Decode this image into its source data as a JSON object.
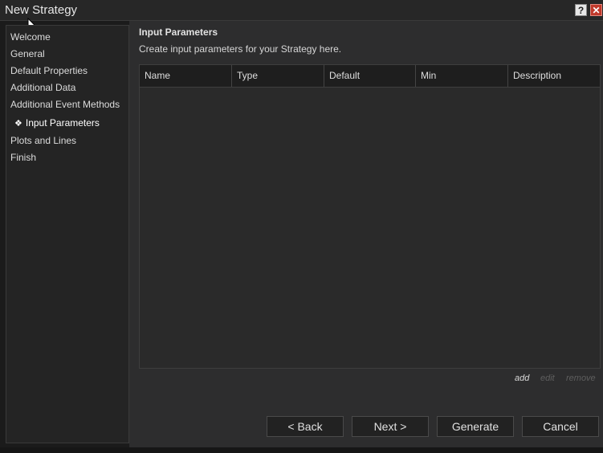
{
  "window": {
    "title": "New Strategy",
    "help_glyph": "?",
    "close_glyph": "✕"
  },
  "sidebar": {
    "items": [
      {
        "label": "Welcome",
        "active": false
      },
      {
        "label": "General",
        "active": false
      },
      {
        "label": "Default Properties",
        "active": false
      },
      {
        "label": "Additional Data",
        "active": false
      },
      {
        "label": "Additional Event Methods",
        "active": false
      },
      {
        "label": "Input Parameters",
        "active": true,
        "bullet": "❖"
      },
      {
        "label": "Plots and Lines",
        "active": false
      },
      {
        "label": "Finish",
        "active": false
      }
    ]
  },
  "main": {
    "title": "Input Parameters",
    "description": "Create input parameters for your Strategy here.",
    "grid": {
      "columns": [
        "Name",
        "Type",
        "Default",
        "Min",
        "Description"
      ],
      "rows": []
    },
    "actions": {
      "add": "add",
      "edit": "edit",
      "remove": "remove"
    }
  },
  "buttons": {
    "back": "< Back",
    "next": "Next >",
    "generate": "Generate",
    "cancel": "Cancel"
  },
  "colors": {
    "background": "#1b1b1b",
    "panel": "#2d2d2e",
    "close_red": "#c0392b",
    "disabled_action": "#5e5e5e"
  }
}
